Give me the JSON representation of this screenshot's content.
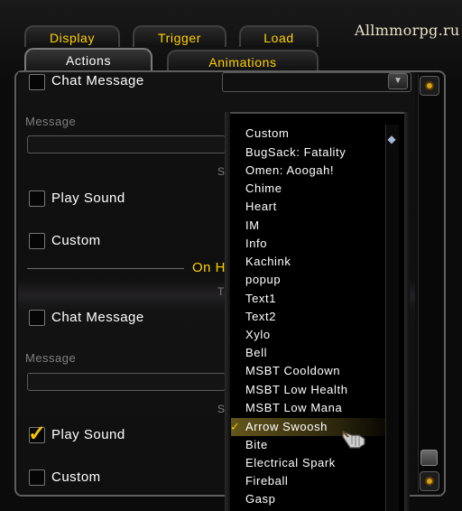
{
  "watermark": "Allmmorpg.ru",
  "tabs": {
    "display": "Display",
    "trigger": "Trigger",
    "load": "Load",
    "actions": "Actions",
    "animations": "Animations"
  },
  "show_section": {
    "chat_message_label": "Chat Message",
    "message_label": "Message",
    "sound_fragment": "S",
    "play_sound_label": "Play Sound",
    "play_sound_checked": false,
    "custom_label": "Custom",
    "custom_checked": false
  },
  "hide_section": {
    "title_fragment": "On H",
    "sub_fragment": "T",
    "chat_message_label": "Chat Message",
    "message_label": "Message",
    "sound_fragment": "S",
    "play_sound_label": "Play Sound",
    "play_sound_checked": true,
    "custom_label": "Custom",
    "custom_checked": false
  },
  "sound_dropdown": {
    "selected": "Arrow Swoosh",
    "options": [
      "Custom",
      "BugSack: Fatality",
      "Omen: Aoogah!",
      "Chime",
      "Heart",
      "IM",
      "Info",
      "Kachink",
      "popup",
      "Text1",
      "Text2",
      "Xylo",
      "Bell",
      "MSBT Cooldown",
      "MSBT Low Health",
      "MSBT Low Mana",
      "Arrow Swoosh",
      "Bite",
      "Electrical Spark",
      "Fireball",
      "Gasp"
    ]
  },
  "colors": {
    "accent_gold": "#ffd100",
    "text_white": "#ffffff",
    "label_gray": "#7f7f7f",
    "panel_bg": "#0d0d0d"
  },
  "icons": {
    "scroll_up": "gold-orb-icon",
    "scroll_down": "gold-orb-icon",
    "dropdown_arrow": "chevron-down-icon",
    "cursor": "hand-pointer-icon"
  }
}
